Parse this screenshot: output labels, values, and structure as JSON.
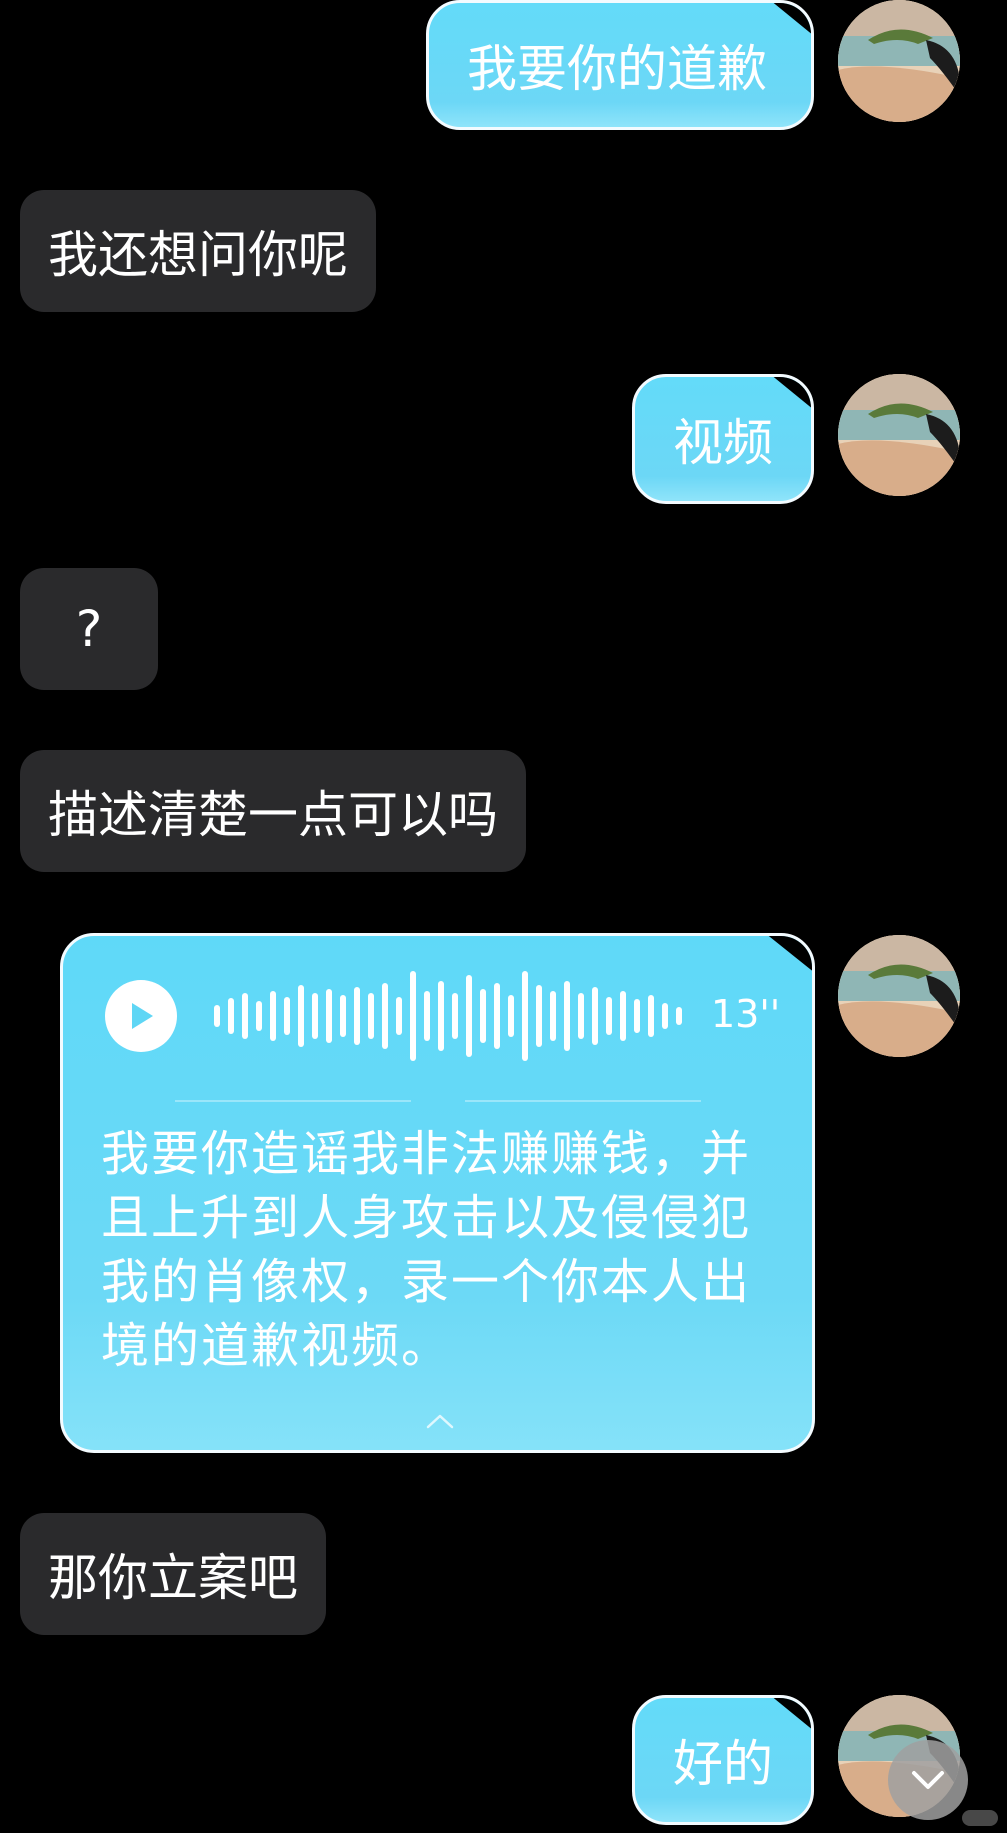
{
  "messages": [
    {
      "side": "out",
      "text": "我要你的道歉"
    },
    {
      "side": "in",
      "text": "我还想问你呢"
    },
    {
      "side": "out",
      "text": "视频"
    },
    {
      "side": "in",
      "text": "?"
    },
    {
      "side": "in",
      "text": "描述清楚一点可以吗"
    },
    {
      "side": "in",
      "text": "那你立案吧"
    },
    {
      "side": "out",
      "text": "好的"
    }
  ],
  "voice_message": {
    "duration": "13''",
    "transcript": "我要你造谣我非法赚赚钱，并且上升到人身攻击以及侵侵犯我的肖像权，录一个你本人出境的道歉视频。"
  },
  "icons": {
    "play": "play-icon",
    "collapse": "chevron-up-icon",
    "scroll_down": "chevron-down-icon",
    "avatar": "user-avatar"
  },
  "colors": {
    "background": "#000000",
    "incoming_bubble": "#2a2a2c",
    "outgoing_bubble": "#63dbf9",
    "text": "#ffffff"
  }
}
